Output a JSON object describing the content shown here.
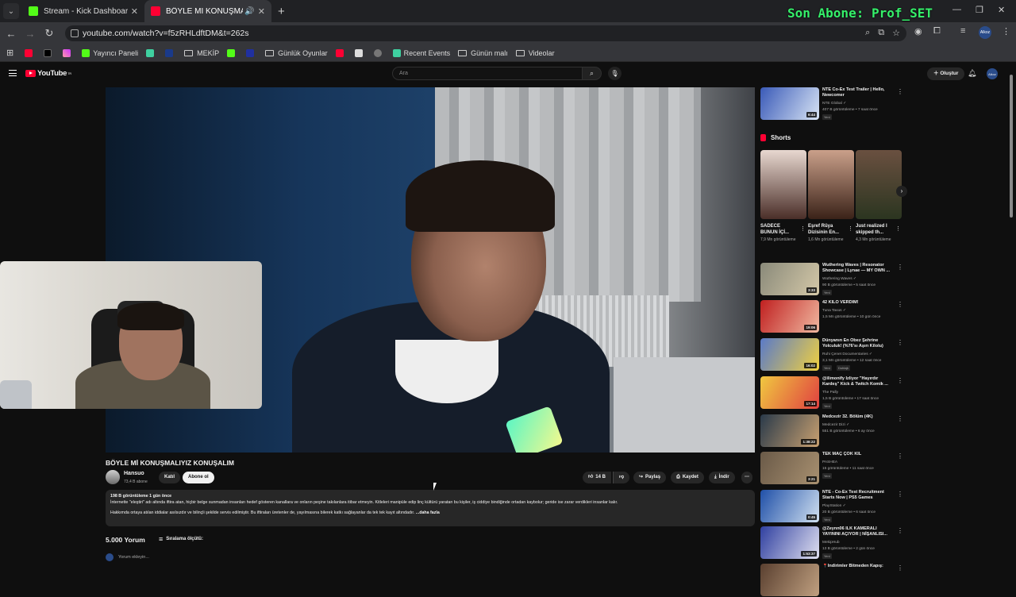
{
  "browser": {
    "tabs": [
      {
        "title": "Stream - Kick Dashboard",
        "favicon": "kick-icon"
      },
      {
        "title": "BÖYLE Mİ KONUŞMALIYIZ KONUŞALIM",
        "favicon": "youtube-icon",
        "active": true
      }
    ],
    "overlay_text": "Son Abone: Prof_SET",
    "url": "youtube.com/watch?v=f5zRHLdftDM&t=262s",
    "profile": "Alkoz",
    "bookmarks": [
      {
        "label": "",
        "icon": "youtube-icon"
      },
      {
        "label": "",
        "icon": "x-icon"
      },
      {
        "label": "",
        "icon": "instagram-icon"
      },
      {
        "label": "Yayıncı Paneli",
        "icon": "kick-icon"
      },
      {
        "label": "",
        "icon": "app-icon"
      },
      {
        "label": "",
        "icon": "arrow-icon"
      },
      {
        "label": "MEKİP",
        "icon": "folder-icon"
      },
      {
        "label": "",
        "icon": "kick-icon"
      },
      {
        "label": "",
        "icon": "app-icon"
      },
      {
        "label": "Günlük Oyunlar",
        "icon": "folder-icon"
      },
      {
        "label": "",
        "icon": "youtube-icon"
      },
      {
        "label": "",
        "icon": "image-icon"
      },
      {
        "label": "",
        "icon": "globe-icon"
      },
      {
        "label": "Recent Events",
        "icon": "app-icon"
      },
      {
        "label": "Günün malı",
        "icon": "folder-icon"
      },
      {
        "label": "Videolar",
        "icon": "folder-icon"
      }
    ]
  },
  "youtube": {
    "logo": "YouTube",
    "logo_sup": "TR",
    "search_placeholder": "Ara",
    "create_label": "Oluştur",
    "video": {
      "title": "BÖYLE Mİ KONUŞMALIYIZ KONUŞALIM",
      "channel": "Hansuo",
      "subscribers": "73,4 B abone",
      "join_label": "Katıl",
      "subscribe_label": "Abone ol",
      "likes": "14 B",
      "share_label": "Paylaş",
      "save_label": "Kaydet",
      "download_label": "İndir",
      "desc_meta": "198 B görüntüleme  1 gün önce",
      "desc_line1": "İnternette \"eleştiri\" adı altında iftira atan, hiçbir belge sunmadan insanları hedef gösteren kanallara ve onların peşine takılanlara itibar etmeyin. Kitleleri manipüle edip linç kültürü yaratan bu kişiler, iş ciddiye bindiğinde ortadan kaybolur; geride ise zarar verdikleri insanlar kalır.",
      "desc_line2": "Hakkımda ortaya atılan iddialar asılsızdır ve bilinçli şekilde servis edilmiştir. Bu iftiraları üretenler de, yayılmasına bilerek katkı sağlayanlar da tek tek kayıt altındadır.",
      "desc_more": "...daha fazla",
      "comments_count": "5.000 Yorum",
      "sort_label": "Sıralama ölçütü:",
      "add_comment_placeholder": "Yorum ekleyin..."
    },
    "shorts_title": "Shorts",
    "shorts": [
      {
        "title": "SADECE BUNUN İÇİ...",
        "views": "7,9 Mn görüntüleme",
        "colors": [
          "#e8d8d0",
          "#4a2e28"
        ]
      },
      {
        "title": "Eşref Rüya Dizisinin En...",
        "views": "1,6 Mn görüntüleme",
        "colors": [
          "#caa08a",
          "#3a2218"
        ]
      },
      {
        "title": "Just realized I skipped th...",
        "views": "4,3 Mn görüntüleme",
        "colors": [
          "#6a5040",
          "#2b3520"
        ]
      }
    ],
    "recommendations": [
      {
        "title": "NTE Co-Ex Test Trailer | Hello, Newcomer",
        "channel": "NTE Global ✓",
        "views": "407 B görüntüleme • 7 saat önce",
        "badge": "Yeni",
        "duration": "6:44",
        "colors": [
          "#3a5ab8",
          "#d8e4f4"
        ]
      },
      {
        "title": "Wuthering Waves | Resonator Showcase | Lynae — MY OWN ...",
        "channel": "Wuthering Waves ✓",
        "views": "90 B görüntüleme • 5 saat önce",
        "badge": "Yeni",
        "duration": "3:33",
        "colors": [
          "#8a8a7a",
          "#d4c8a8"
        ]
      },
      {
        "title": "42 KİLO VERDİM!",
        "channel": "Tuna Tavus ✓",
        "views": "1,5 Mn görüntüleme • 10 gün önce",
        "badge": "",
        "duration": "19:06",
        "colors": [
          "#c02020",
          "#f0b8a0"
        ]
      },
      {
        "title": "Dünyanın En Obez Şehrine Yolculuk! (%76'sı Aşırı Kilolu)",
        "channel": "Ruhi Çenet Documentaries ✓",
        "views": "3,1 Mn görüntüleme • 12 saat önce",
        "badge": "Yeni",
        "extra": "Dublajlı",
        "duration": "16:02",
        "colors": [
          "#5a7ac8",
          "#f0d040"
        ]
      },
      {
        "title": "@ilimonify İzliyor \"Hayırdır Kardeş\" Kick & Twitch Komik ...",
        "channel": "The Pally",
        "views": "1,5 B görüntüleme • 17 saat önce",
        "badge": "Yeni",
        "duration": "17:14",
        "colors": [
          "#f0c840",
          "#e04040"
        ]
      },
      {
        "title": "Medcezir 32. Bölüm (4K)",
        "channel": "Medcezir Dizi ✓",
        "views": "551 B görüntüleme • 6 ay önce",
        "badge": "",
        "duration": "1:38:22",
        "colors": [
          "#2a3a4a",
          "#c8a070"
        ]
      },
      {
        "title": "TEK MAÇ ÇOK KIL",
        "channel": "PASHEA",
        "views": "15 görüntüleme • 11 saat önce",
        "badge": "Yeni",
        "duration": "3:21",
        "colors": [
          "#6a5a48",
          "#a89070"
        ]
      },
      {
        "title": "NTE - Co-Ex Test Recruitment Starts Now | PS5 Games",
        "channel": "PlayStation ✓",
        "views": "20 B görüntüleme • 6 saat önce",
        "badge": "Yeni",
        "duration": "0:45",
        "colors": [
          "#2050a8",
          "#d0e0f0"
        ]
      },
      {
        "title": "@Zeynn06  İLK KAMERALI YAYININI AÇIYOR | NİŞANLISI...",
        "channel": "MekipHub",
        "views": "13 B görüntüleme • 2 gün önce",
        "badge": "Yeni",
        "duration": "1:53:37",
        "colors": [
          "#3040a0",
          "#e0e0f0"
        ]
      },
      {
        "title": "📍İndirimler Bitmeden Kapış:",
        "channel": "",
        "views": "",
        "badge": "",
        "duration": "",
        "colors": [
          "#5a4030",
          "#c0a080"
        ]
      }
    ]
  }
}
